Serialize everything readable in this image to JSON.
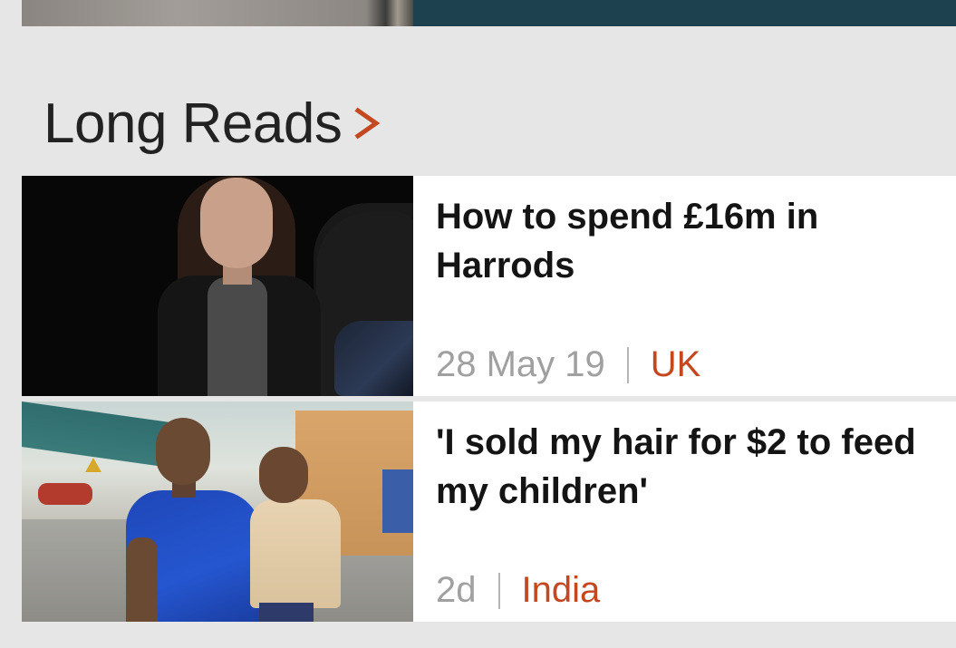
{
  "section": {
    "title": "Long Reads",
    "chevron_icon": "chevron-right-icon",
    "accent_color": "#c4471f"
  },
  "articles": [
    {
      "headline_line1": "How to spend £16m in",
      "headline_line2": "Harrods",
      "time": "28 May 19",
      "category": "UK"
    },
    {
      "headline_line1": "'I sold my hair for $2 to feed",
      "headline_line2": "my children'",
      "time": "2d",
      "category": "India"
    }
  ]
}
